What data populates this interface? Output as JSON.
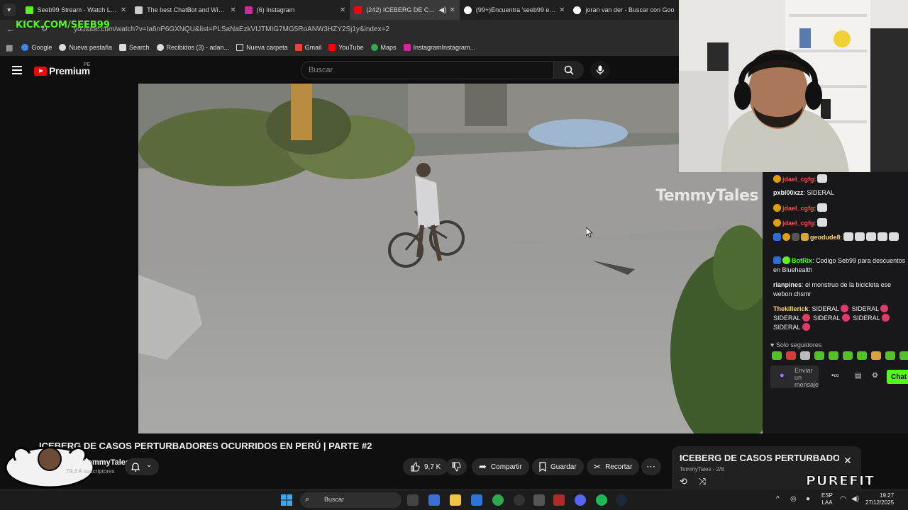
{
  "browser": {
    "tabs": [
      {
        "title": "Seeb99 Stream - Watch Live on",
        "favicon_color": "#53fc18",
        "active": false
      },
      {
        "title": "The best ChatBot and Widgets",
        "favicon_color": "#cccccc",
        "active": false
      },
      {
        "title": "(6) Instagram",
        "favicon_color": "#d6249f",
        "active": false
      },
      {
        "title": "(242) ICEBERG DE CASOS P",
        "favicon_color": "#ff0000",
        "active": true
      },
      {
        "title": "(99+)Encuentra 'seeb99 en el co",
        "favicon_color": "#ffffff",
        "active": false
      },
      {
        "title": "joran van der - Buscar con Goo",
        "favicon_color": "#4285f4",
        "active": false
      }
    ],
    "url": "youtube.com/watch?v=Ia6nP6GXNQU&list=PLSaNaEzkVIJTMIG7MG5RoANW3HZY2Sj1y&index=2",
    "bookmarks": [
      {
        "label": "Google",
        "color": "#4285f4"
      },
      {
        "label": "Nueva pestaña",
        "color": "#dddddd"
      },
      {
        "label": "Search",
        "color": "#dddddd"
      },
      {
        "label": "Recibidos (3) - adan...",
        "color": "#dddddd"
      },
      {
        "label": "Nueva carpeta",
        "color": "#dddddd"
      },
      {
        "label": "Gmail",
        "color": "#ea4335"
      },
      {
        "label": "YouTube",
        "color": "#ff0000"
      },
      {
        "label": "Maps",
        "color": "#34a853"
      },
      {
        "label": "InstagramInstagram...",
        "color": "#d6249f"
      }
    ]
  },
  "overlay": {
    "kick_label": "KICK.COM/SEEB99",
    "sponsor": "PUREFIT"
  },
  "youtube": {
    "premium_label": "Premium",
    "region": "PE",
    "search_placeholder": "Buscar",
    "video_watermark": "TemmyTales",
    "video_title": "ICEBERG DE CASOS PERTURBADORES OCURRIDOS EN PERÚ | PARTE #2",
    "channel": "TemmyTales",
    "subscribers": "79,4 K suscriptores",
    "likes": "9,7 K",
    "share": "Compartir",
    "save": "Guardar",
    "clip": "Recortar",
    "playlist_title": "ICEBERG DE CASOS PERTURBADO...",
    "playlist_sub": "TemmyTales - 2/8"
  },
  "chat": {
    "messages": [
      {
        "user": "jdael_cgfg",
        "color": "#ff4a4a",
        "text": ":"
      },
      {
        "user": "pxbl00xzz",
        "color": "#ffffff",
        "text": ": SIDERAL"
      },
      {
        "user": "jdael_cgfg",
        "color": "#ff4a4a",
        "text": ":"
      },
      {
        "user": "jdael_cgfg",
        "color": "#ff4a4a",
        "text": ":"
      },
      {
        "user": "geodude8",
        "color": "#ffd966",
        "text": ":"
      },
      {
        "user": "BotRix",
        "color": "#53fc18",
        "text": ": Codigo Seb99 para descuentos en Bluehealth"
      },
      {
        "user": "rianpines",
        "color": "#ffffff",
        "text": ": el monstruo de la bicicleta ese webon chsmr"
      },
      {
        "user": "Thekillerick",
        "color": "#ffd966",
        "text": ": SIDERAL"
      },
      {
        "text_line2": "SIDERAL",
        "text_line3": "SIDERAL",
        "text_line4": "SIDERAL",
        "text_line5": "SIDERAL",
        "text_line6": "SIDERAL"
      }
    ],
    "followers_only": "Solo seguidores",
    "input_placeholder": "Enviar un mensaje",
    "send_label": "Chat"
  },
  "taskbar": {
    "search_placeholder": "Buscar",
    "lang_top": "ESP",
    "lang_bottom": "LAA",
    "time": "19:27",
    "date": "27/12/2025"
  },
  "icons": {
    "search": "search-icon",
    "mic": "mic-icon",
    "bell": "bell-icon",
    "like": "thumbs-up-icon",
    "dislike": "thumbs-down-icon",
    "share": "share-icon",
    "save": "bookmark-icon",
    "clip": "scissors-icon",
    "more": "more-icon",
    "close": "close-icon",
    "loop": "loop-icon",
    "shuffle": "shuffle-icon"
  }
}
